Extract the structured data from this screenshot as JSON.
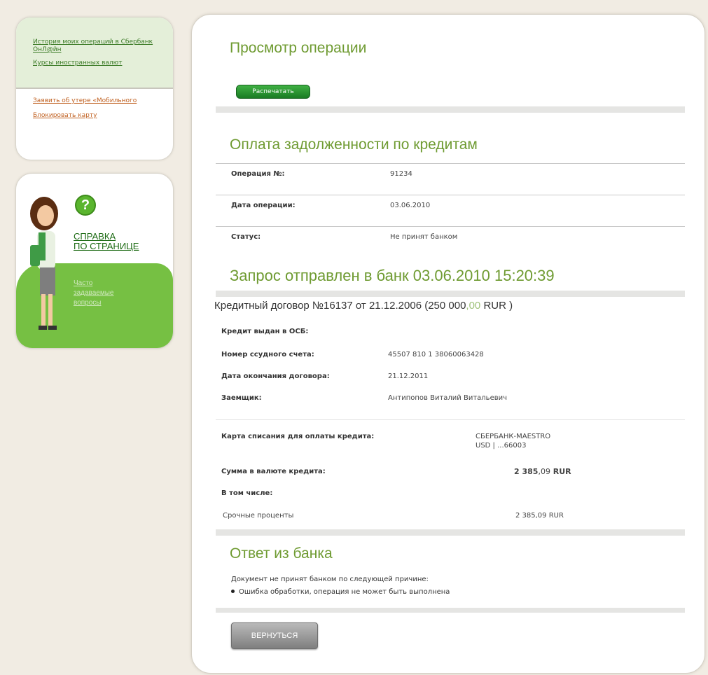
{
  "sidebar": {
    "links_top": [
      "История моих операций в Сбербанк ОнЛ@йн",
      "Курсы иностранных валют"
    ],
    "links_bottom": [
      "Заявить об утере «Мобильного",
      "Блокировать карту"
    ],
    "help": {
      "icon_label": "?",
      "title_line1": "СПРАВКА",
      "title_line2": "ПО СТРАНИЦЕ",
      "links": [
        "Часто",
        "задаваемые",
        "вопросы"
      ]
    }
  },
  "main": {
    "title": "Просмотр операции",
    "print_button": "Распечатать",
    "section_title": "Оплата задолженности по кредитам",
    "operation": {
      "number_label": "Операция №:",
      "number_value": "91234",
      "date_label": "Дата операции:",
      "date_value": "03.06.2010",
      "status_label": "Статус:",
      "status_value": "Не принят банком"
    },
    "request_title": "Запрос отправлен в банк 03.06.2010 15:20:39",
    "contract": {
      "title_pre": "Кредитный договор №16137 от 21.12.2006 (250 000",
      "title_cents": ",00",
      "title_post": " RUR )",
      "issued_label": "Кредит выдан в ОСБ:",
      "account_label": "Номер ссудного счета:",
      "account_value": "45507 810 1 38060063428",
      "end_label": "Дата окончания договора:",
      "end_value": "21.12.2011",
      "borrower_label": "Заемщик:",
      "borrower_value": "Антипопов Виталий Витальевич",
      "card_label": "Карта списания для оплаты кредита:",
      "card_line1": "СБЕРБАНК-MAESTRO",
      "card_line2": "USD | ...66003",
      "sum_label": "Сумма в валюте кредита:",
      "sum_main": "2 385",
      "sum_cents": ",09",
      "sum_cur": " RUR",
      "incl_label": "В том числе:",
      "interest_label": "Срочные проценты",
      "interest_value": "2 385,09 RUR"
    },
    "answer_title": "Ответ из банка",
    "answer_intro": "Документ не принят банком по следующей причине:",
    "answer_reason": "Ошибка обработки, операция не может быть выполнена",
    "back_button": "ВЕРНУТЬСЯ"
  }
}
